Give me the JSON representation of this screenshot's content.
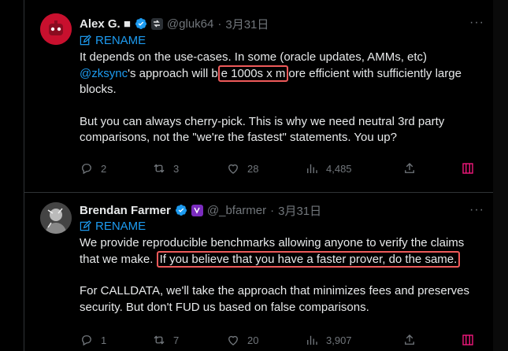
{
  "tweets": [
    {
      "name": "Alex G. ■",
      "handle": "@gluk64",
      "separator": "·",
      "date": "3月31日",
      "rename_label": "RENAME",
      "body": {
        "p1_a": "It depends on the use-cases. In some (oracle updates, AMMs, etc)",
        "p1_mention": "@zksync",
        "p1_b": "'s approach will b",
        "p1_highlight": "e 1000s x m",
        "p1_c": "ore efficient with sufficiently large blocks.",
        "p2": "But you can always cherry-pick. This is why we need neutral 3rd party comparisons, not the \"we're the fastest\" statements. You up?"
      },
      "stats": {
        "replies": "2",
        "retweets": "3",
        "likes": "28",
        "views": "4,485"
      }
    },
    {
      "name": "Brendan Farmer",
      "handle": "@_bfarmer",
      "separator": "·",
      "date": "3月31日",
      "rename_label": "RENAME",
      "body": {
        "p1_a": "We provide reproducible benchmarks allowing anyone to  verify the claims that we make.",
        "p1_highlight": "If you believe that you have a faster prover, do the same.",
        "p2": "For CALLDATA, we'll take the approach that minimizes fees and preserves security. But don't FUD us based on false comparisons."
      },
      "stats": {
        "replies": "1",
        "retweets": "7",
        "likes": "20",
        "views": "3,907"
      }
    }
  ],
  "more_glyph": "···",
  "colors": {
    "accent": "#1d9bf0",
    "highlight_box": "#ee5a5a",
    "muted": "#71767b",
    "bookmark": "#f91880"
  }
}
